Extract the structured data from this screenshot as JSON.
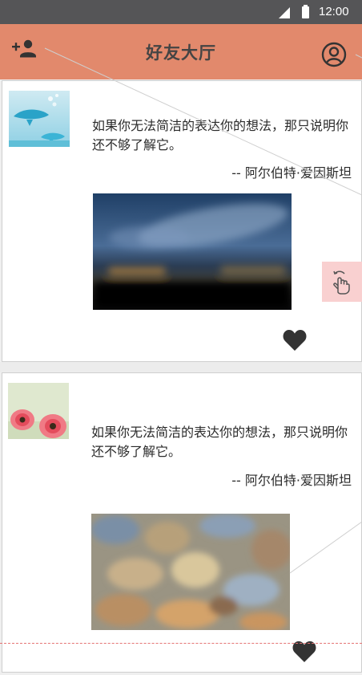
{
  "status_bar": {
    "time": "12:00",
    "icons": [
      "signal-icon",
      "battery-icon"
    ]
  },
  "app_bar": {
    "title": "好友大厅",
    "left_icon": "add-friend-icon",
    "right_icon": "profile-icon",
    "color": "#e2896c"
  },
  "posts": [
    {
      "avatar": "dolphin-avatar",
      "quote": "如果你无法简洁的表达你的想法，那只说明你还不够了解它。",
      "author": "-- 阿尔伯特·爱因斯坦",
      "image": "night-sky-photo",
      "like_icon": "heart-icon"
    },
    {
      "avatar": "flower-avatar",
      "quote": "如果你无法简洁的表达你的想法，那只说明你还不够了解它。",
      "author": "-- 阿尔伯特·爱因斯坦",
      "image": "autumn-leaves-photo",
      "like_icon": "heart-icon"
    }
  ],
  "floating_button": {
    "icon": "hand-tap-icon",
    "color": "#f9d0d0"
  }
}
